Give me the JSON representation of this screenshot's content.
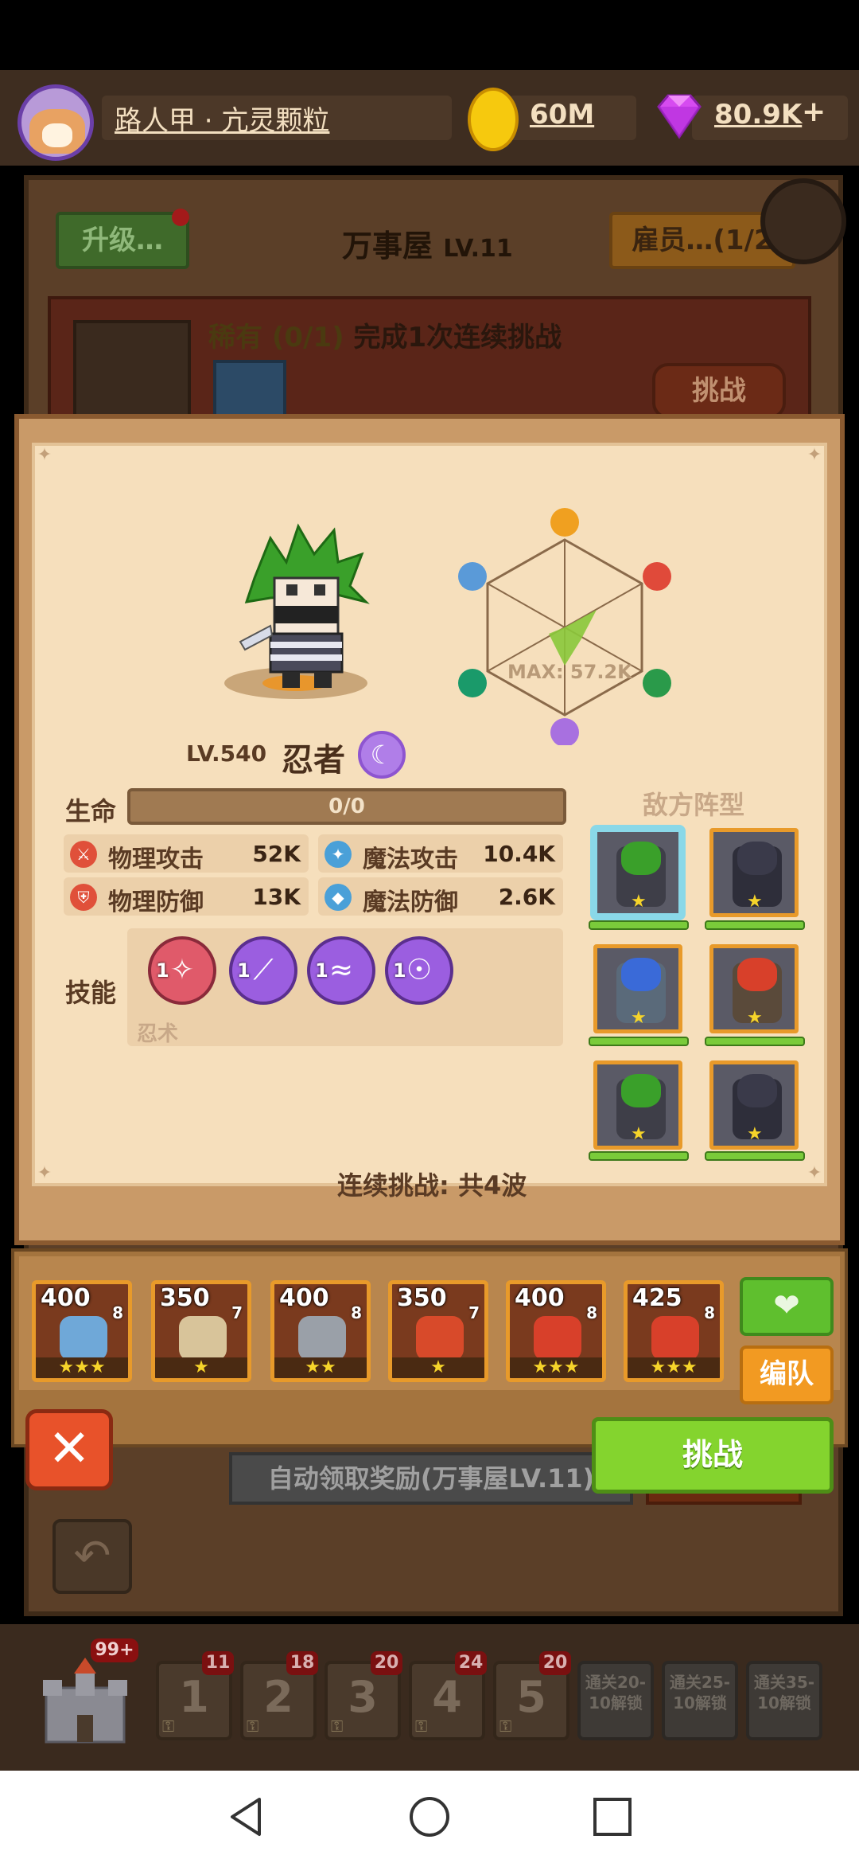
{
  "player": {
    "name": "路人甲 · 亢灵颗粒",
    "gold": "60M",
    "gems": "80.9K",
    "gem_add": "+"
  },
  "building": {
    "upgrade_label": "升级…",
    "title": "万事屋",
    "level": "LV.11",
    "employees_label": "雇员…(1/2",
    "task_rarity": "稀有 (0/1)",
    "task_text": "完成1次连续挑战",
    "task_button": "挑战",
    "auto_claim_label": "自动领取奖励(万事屋LV.11)",
    "back_icon": "↶"
  },
  "hero": {
    "level": "LV.540",
    "name": "忍者",
    "radar_max": "MAX: 57.2K",
    "hp_label": "生命",
    "hp_value": "0/0",
    "stats": [
      {
        "label": "物理攻击",
        "value": "52K",
        "icon": "sword-icon",
        "color": "#e0503a"
      },
      {
        "label": "魔法攻击",
        "value": "10.4K",
        "icon": "magic-staff-icon",
        "color": "#4aa0d8"
      },
      {
        "label": "物理防御",
        "value": "13K",
        "icon": "armor-icon",
        "color": "#e0503a"
      },
      {
        "label": "魔法防御",
        "value": "2.6K",
        "icon": "magic-shield-icon",
        "color": "#4aa0d8"
      }
    ],
    "skills_label": "技能",
    "skills": [
      {
        "level": "1",
        "icon": "shuriken-skill-icon"
      },
      {
        "level": "1",
        "icon": "slash-skill-icon"
      },
      {
        "level": "1",
        "icon": "dash-skill-icon"
      },
      {
        "level": "1",
        "icon": "stealth-skill-icon"
      }
    ],
    "skill_caption": "忍术"
  },
  "enemy": {
    "title": "敌方阵型",
    "units": [
      {
        "name": "ninja-green",
        "stars": "★"
      },
      {
        "name": "ninja-dark",
        "stars": "★"
      },
      {
        "name": "knight-blue",
        "stars": "★"
      },
      {
        "name": "warrior-red",
        "stars": "★"
      },
      {
        "name": "ninja-green",
        "stars": "★"
      },
      {
        "name": "ninja-dark",
        "stars": "★"
      }
    ],
    "waves": "连续挑战: 共4波"
  },
  "roster": [
    {
      "cost": "400",
      "level": "8",
      "stars": "★★★",
      "color": "#6fa8d8"
    },
    {
      "cost": "350",
      "level": "7",
      "stars": "★",
      "color": "#d8c49a"
    },
    {
      "cost": "400",
      "level": "8",
      "stars": "★★",
      "color": "#9aa0a8"
    },
    {
      "cost": "350",
      "level": "7",
      "stars": "★",
      "color": "#d84a2a"
    },
    {
      "cost": "400",
      "level": "8",
      "stars": "★★★",
      "color": "#d8402a"
    },
    {
      "cost": "425",
      "level": "8",
      "stars": "★★★",
      "color": "#d8402a"
    }
  ],
  "buttons": {
    "heart_icon": "❤",
    "team": "编队",
    "close": "✕",
    "challenge": "挑战"
  },
  "stages": [
    {
      "num": "1",
      "badge": "11"
    },
    {
      "num": "2",
      "badge": "18"
    },
    {
      "num": "3",
      "badge": "20"
    },
    {
      "num": "4",
      "badge": "24"
    },
    {
      "num": "5",
      "badge": "20"
    }
  ],
  "locked_stages": [
    "通关20-10解锁",
    "通关25-10解锁",
    "通关35-10解锁"
  ],
  "castle_badge": "99+",
  "colors": {
    "panel": "#f6dfbc",
    "frame": "#c99a68",
    "challenge": "#84d42e",
    "team": "#f29a22",
    "close": "#e8522a"
  }
}
